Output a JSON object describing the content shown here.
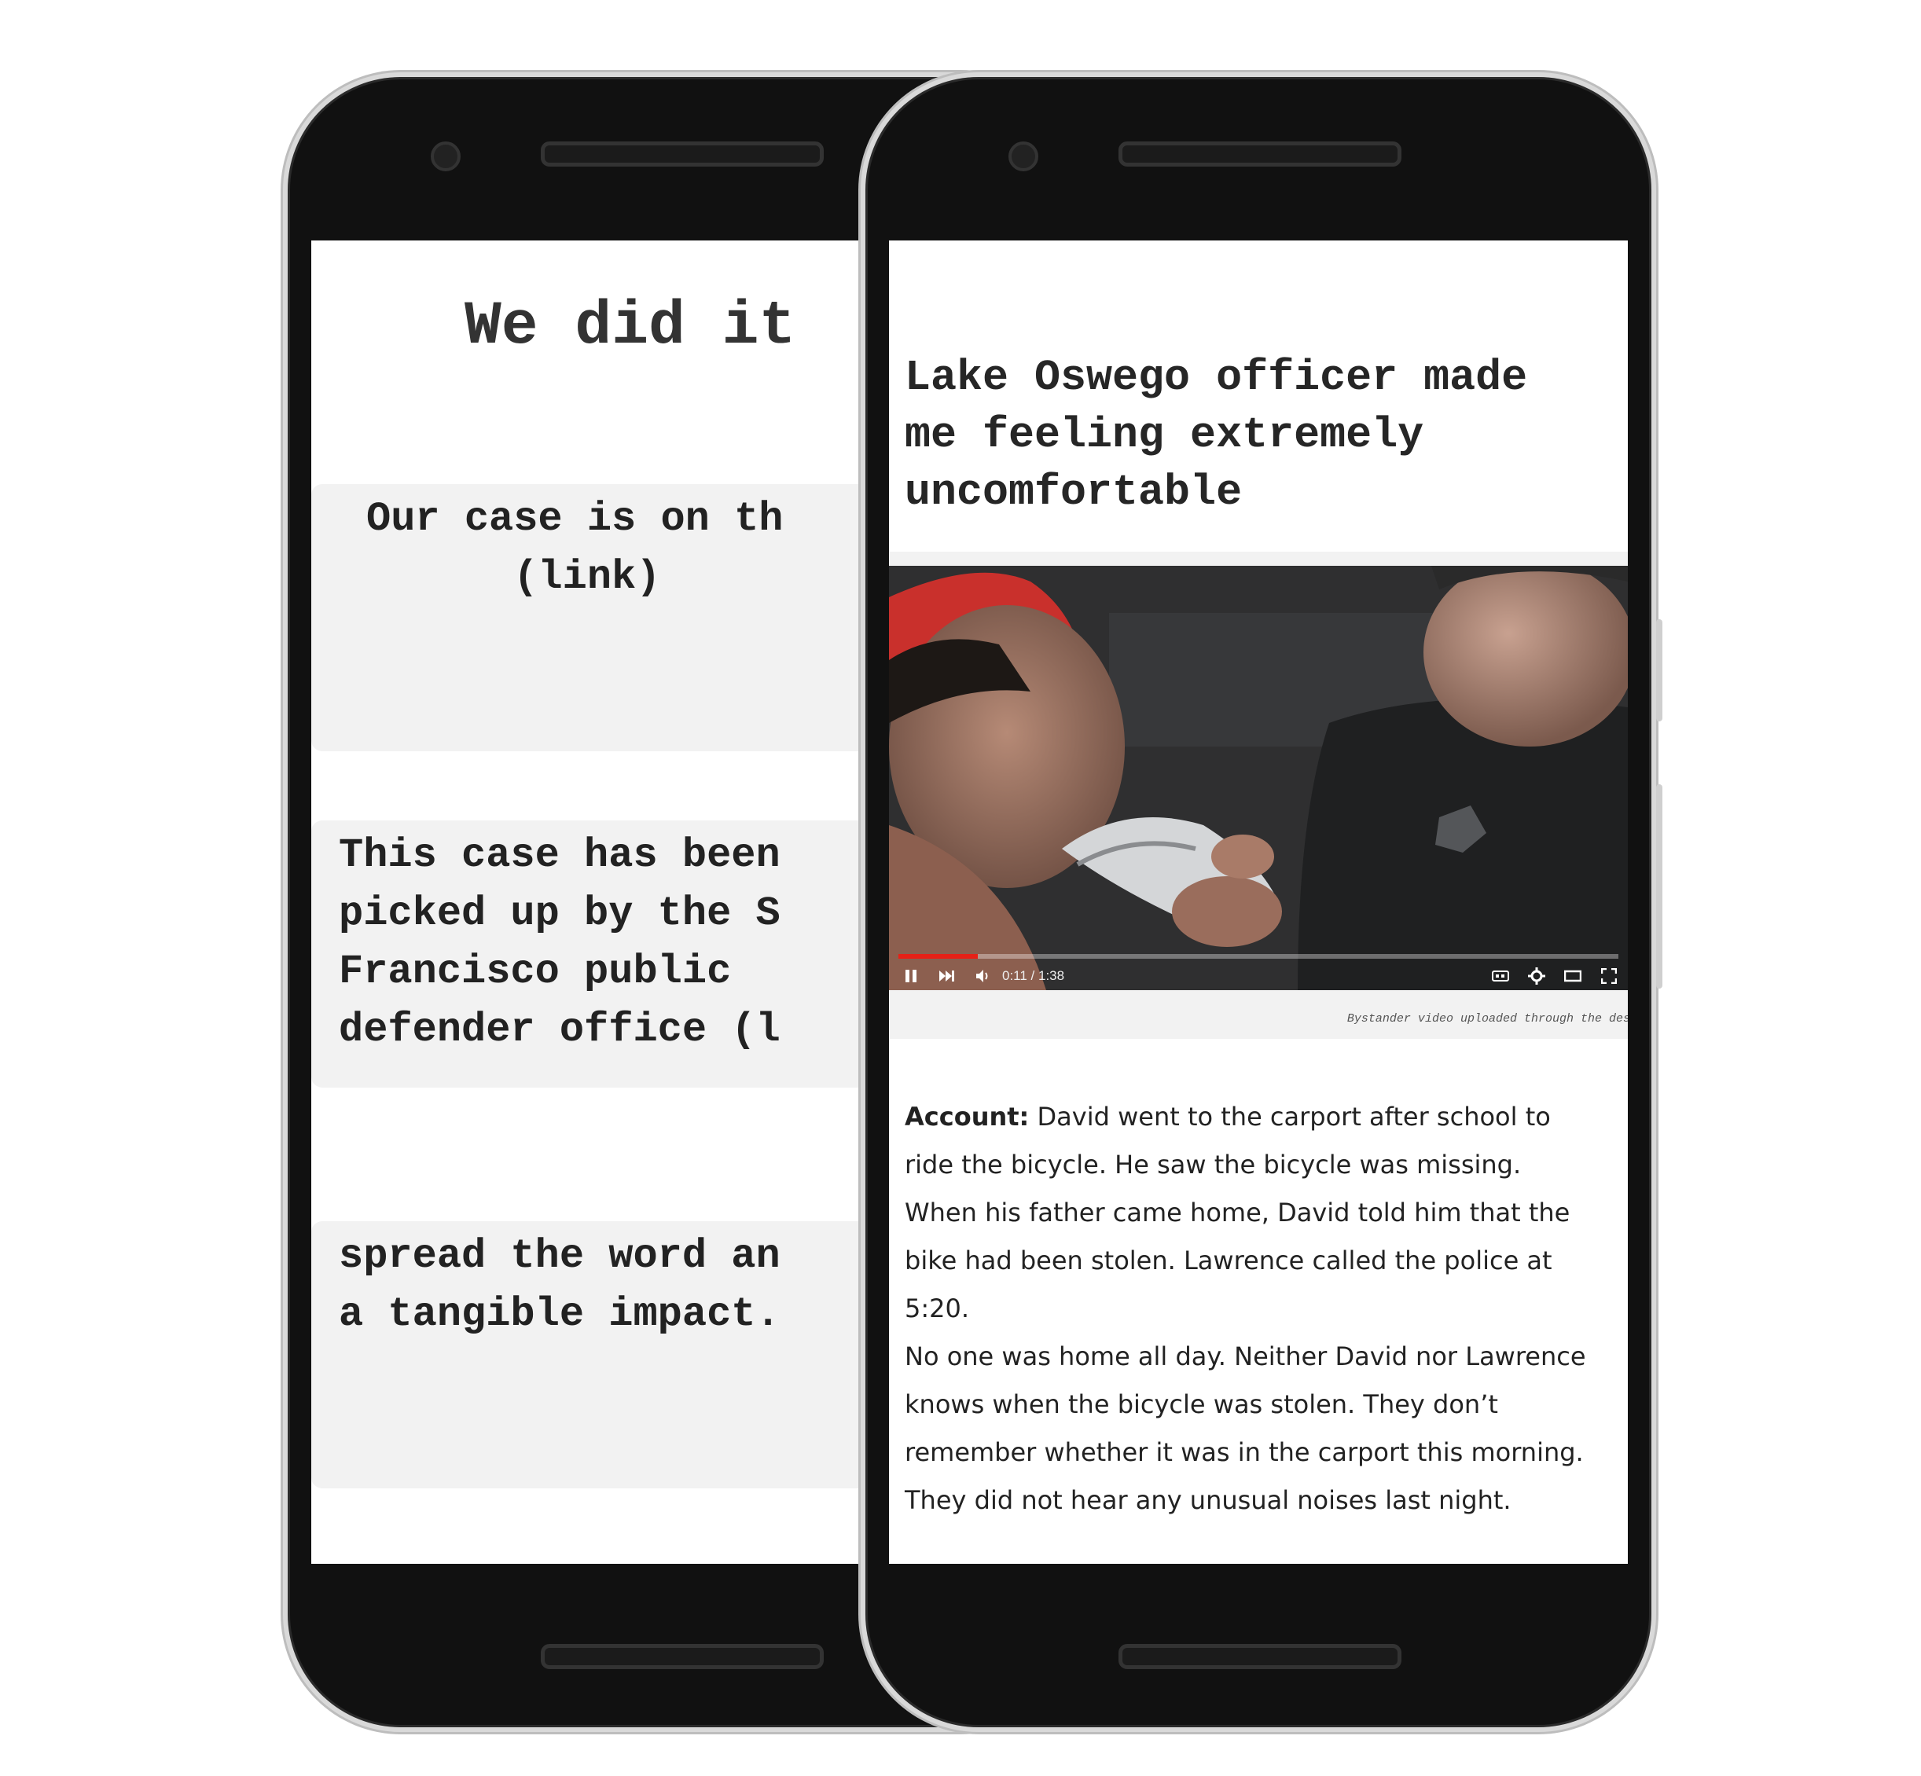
{
  "left_phone": {
    "title": "We did it",
    "cards": [
      {
        "text": "Our case is on th\n      (link)"
      },
      {
        "text": "This case has been\npicked up by the S\nFrancisco public\ndefender office (l"
      },
      {
        "text": "spread the word an\na tangible impact."
      }
    ]
  },
  "right_phone": {
    "headline": "Lake Oswego officer made\nme feeling extremely\nuncomfortable",
    "video": {
      "time": "0:11 / 1:38",
      "progress": 0.11,
      "caption": "Bystander video uploaded through the deskto"
    },
    "account": {
      "label": "Account:",
      "para1": " David went to the carport after school to\nride the bicycle. He saw the bicycle was missing.\nWhen his father came home, David told him that the\nbike had been stolen. Lawrence called the police at\n5:20.",
      "para2": "No one was home all day. Neither David nor Lawrence\nknows when the bicycle was stolen. They don’t\nremember whether it was in the carport this morning.\nThey did not hear any unusual noises last night."
    }
  },
  "icons": [
    "pause-icon",
    "next-icon",
    "volume-icon",
    "cc-icon",
    "gear-icon",
    "theater-icon",
    "fullscreen-icon"
  ]
}
